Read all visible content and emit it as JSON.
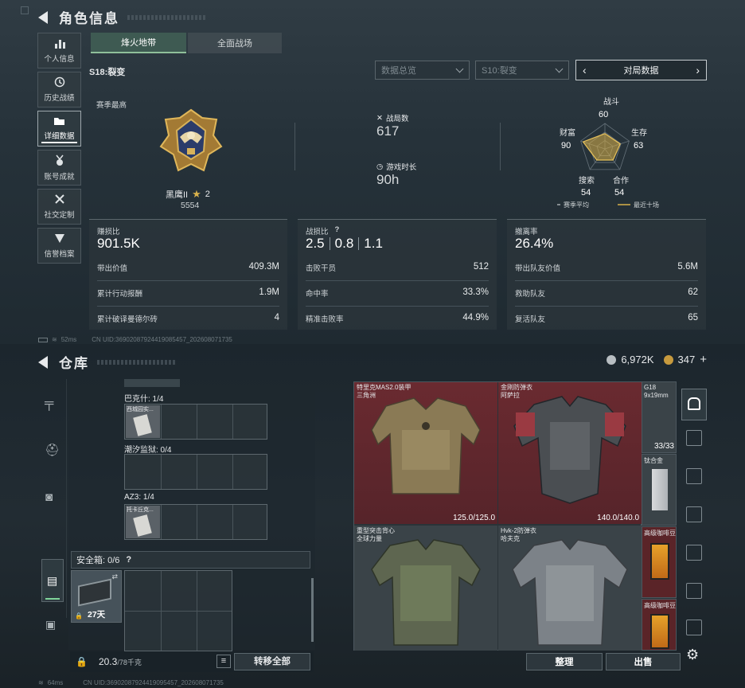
{
  "character": {
    "title": "角色信息",
    "sidebar": [
      {
        "label": "个人信息",
        "icon": "bar-chart-icon",
        "glyph": "▮"
      },
      {
        "label": "历史战绩",
        "icon": "history-icon",
        "glyph": "◴"
      },
      {
        "label": "详细数据",
        "icon": "folder-icon",
        "glyph": "▬"
      },
      {
        "label": "账号成就",
        "icon": "medal-icon",
        "glyph": "✪"
      },
      {
        "label": "社交定制",
        "icon": "tools-icon",
        "glyph": "✕"
      },
      {
        "label": "信誉档案",
        "icon": "shield-icon",
        "glyph": "▼"
      }
    ],
    "mode_tabs": [
      "烽火地带",
      "全面战场"
    ],
    "season_label": "S18:裂变",
    "filter_overview": "数据总览",
    "filter_season": "S10:裂变",
    "match_data_label": "对局数据",
    "season_best_label": "赛季最高",
    "rank_name": "黑鹰II",
    "rank_stars": "2",
    "rank_points": "5554",
    "matches_label": "战局数",
    "matches_value": "617",
    "playtime_label": "游戏时长",
    "playtime_value": "90h",
    "radar": {
      "axes": [
        {
          "label": "战斗",
          "value": "60"
        },
        {
          "label": "生存",
          "value": "63"
        },
        {
          "label": "合作",
          "value": "54"
        },
        {
          "label": "搜索",
          "value": "54"
        },
        {
          "label": "财富",
          "value": "90"
        }
      ],
      "legend_avg": "赛季平均",
      "legend_recent": "最近十场",
      "color_recent": "#d8b048"
    },
    "panel_earnings": {
      "label": "赚损比",
      "value": "901.5K",
      "rows": [
        {
          "label": "带出价值",
          "value": "409.3M"
        },
        {
          "label": "累计行动报酬",
          "value": "1.9M"
        },
        {
          "label": "累计破译曼德尔砖",
          "value": "4"
        }
      ]
    },
    "panel_combat": {
      "label": "战损比",
      "help": "?",
      "values": [
        "2.5",
        "0.8",
        "1.1"
      ],
      "rows": [
        {
          "label": "击败干员",
          "value": "512"
        },
        {
          "label": "命中率",
          "value": "33.3%"
        },
        {
          "label": "精准击败率",
          "value": "44.9%"
        }
      ]
    },
    "panel_extract": {
      "label": "撤离率",
      "value": "26.4%",
      "rows": [
        {
          "label": "带出队友价值",
          "value": "5.6M"
        },
        {
          "label": "救助队友",
          "value": "62"
        },
        {
          "label": "复活队友",
          "value": "65"
        }
      ]
    },
    "footer_ping": "52ms",
    "footer_uid": "CN UID:3690208792441908545​7_202608071735"
  },
  "warehouse": {
    "title": "仓库",
    "currency_1": "6,972K",
    "currency_2": "347",
    "currency_add": "+",
    "containers": [
      {
        "label": "巴克什: 1/4",
        "item": "西城园实..."
      },
      {
        "label": "潮汐监狱: 0/4",
        "item": ""
      },
      {
        "label": "AZ3: 1/4",
        "item": "托卡丘克..."
      }
    ],
    "safe_box_label": "安全箱: 0/6",
    "safe_box_help": "?",
    "safe_box_time": "27天",
    "weight": "20.3",
    "weight_max": "/78千克",
    "transfer_all": "转移全部",
    "armors": [
      {
        "name": "特里克MAS2.0装甲",
        "sub": "三角洲",
        "dur": "125.0/125.0"
      },
      {
        "name": "金刚防弹衣",
        "sub": "阿萨拉",
        "dur": "140.0/140.0"
      },
      {
        "name": "重型突击背心",
        "sub": "全球力量",
        "dur": ""
      },
      {
        "name": "Hvk-2防弹衣",
        "sub": "哈夫克",
        "dur": ""
      }
    ],
    "side_items": [
      {
        "name": "G18",
        "sub": "9x19mm",
        "count": "33/33"
      },
      {
        "name": "钛合金",
        "sub": "",
        "count": ""
      },
      {
        "name": "高级咖啡豆",
        "sub": "",
        "count": ""
      },
      {
        "name": "高级咖啡豆",
        "sub": "",
        "count": ""
      }
    ],
    "sort_button": "整理",
    "sell_button": "出售",
    "footer_ping": "64ms",
    "footer_uid": "CN UID:36902087924419095457_202608071735"
  }
}
